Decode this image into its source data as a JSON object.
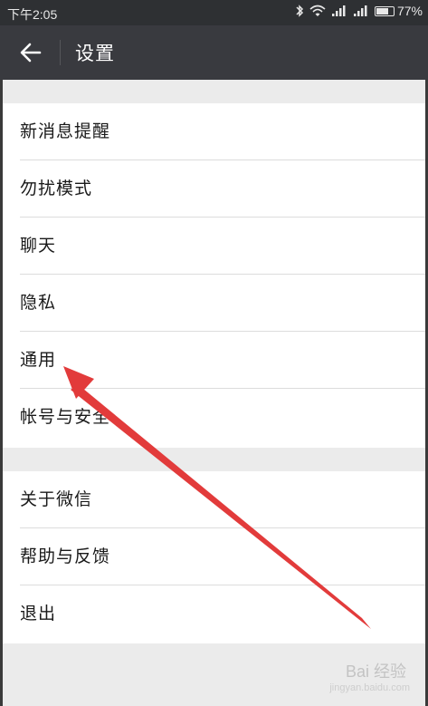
{
  "status_bar": {
    "time": "下午2:05",
    "battery": "77%",
    "battery_level": 0.77,
    "icons": [
      "bluetooth-icon",
      "wifi-icon",
      "signal-icon",
      "signal-icon",
      "battery-icon"
    ]
  },
  "app_bar": {
    "back_icon": "arrow-left-icon",
    "title": "设置"
  },
  "groups": [
    {
      "items": [
        {
          "label": "新消息提醒"
        },
        {
          "label": "勿扰模式"
        },
        {
          "label": "聊天"
        },
        {
          "label": "隐私"
        },
        {
          "label": "通用"
        },
        {
          "label": "帐号与安全"
        }
      ]
    },
    {
      "items": [
        {
          "label": "关于微信"
        },
        {
          "label": "帮助与反馈"
        },
        {
          "label": "退出"
        }
      ]
    }
  ],
  "annotation": {
    "color": "#e23b3b",
    "points_to": "通用"
  },
  "watermark": {
    "text": "Bai 经验",
    "subtext": "jingyan.baidu.com"
  }
}
